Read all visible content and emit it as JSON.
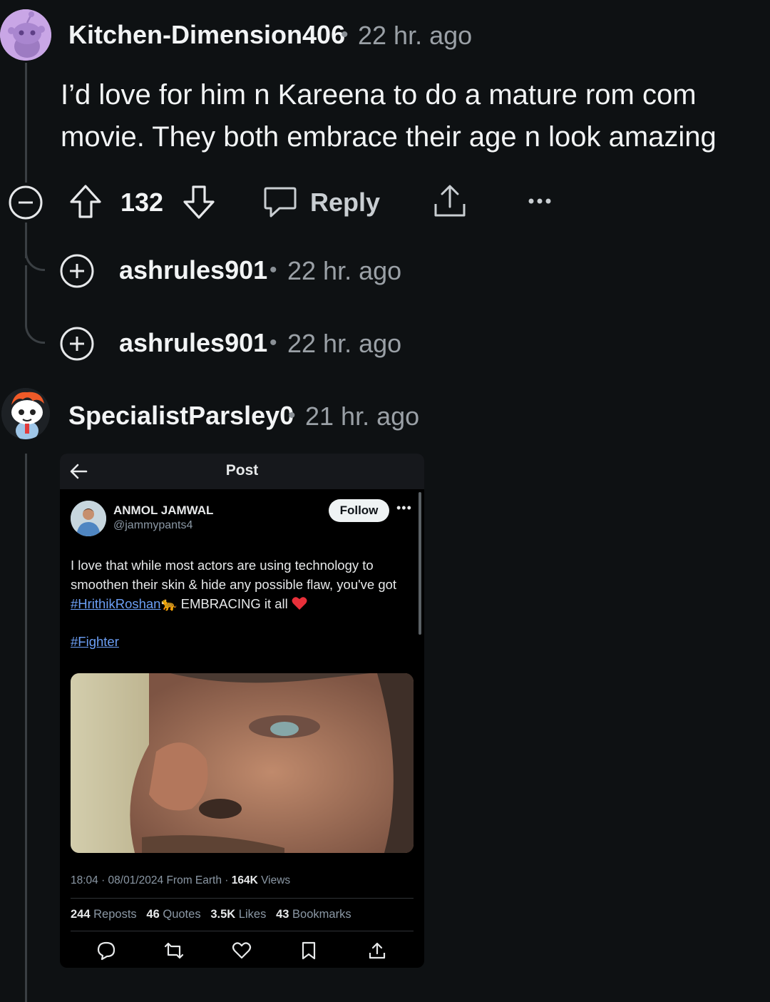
{
  "colors": {
    "background": "#0e1113",
    "thread_line": "#3a3f43",
    "link": "#6c9ff5",
    "heart": "#e8303a"
  },
  "comments": [
    {
      "username": "Kitchen-Dimension406",
      "separator": "•",
      "time": "22 hr. ago",
      "body": "I’d love for him n Kareena to do a mature rom com movie. They both embrace their age n look amazing",
      "score": "132",
      "reply_label": "Reply",
      "icons": [
        "collapse-icon",
        "upvote-icon",
        "downvote-icon",
        "comment-bubble-icon",
        "share-icon",
        "more-icon"
      ]
    }
  ],
  "collapsed_replies": [
    {
      "username": "ashrules901",
      "separator": "•",
      "time": "22 hr. ago",
      "icon": "expand-icon"
    },
    {
      "username": "ashrules901",
      "separator": "•",
      "time": "22 hr. ago",
      "icon": "expand-icon"
    }
  ],
  "second_comment": {
    "username": "SpecialistParsley0",
    "separator": "•",
    "time": "21 hr. ago"
  },
  "embedded_post": {
    "header_title": "Post",
    "author_name": "ANMOL JAMWAL",
    "author_handle": "@jammypants4",
    "follow_label": "Follow",
    "more_label": "•••",
    "text_part1": "I love that while most actors are using technology to smoothen their skin & hide any possible flaw, you've got ",
    "text_link": "#HrithikRoshan",
    "text_part2": " EMBRACING it all",
    "hashtag": "#Fighter",
    "meta_prefix": "18:04 · 08/01/2024 From Earth · ",
    "views_count": "164K",
    "views_label": " Views",
    "stats": [
      {
        "count": "244",
        "label": "Reposts"
      },
      {
        "count": "46",
        "label": "Quotes"
      },
      {
        "count": "3.5K",
        "label": "Likes"
      },
      {
        "count": "43",
        "label": "Bookmarks"
      }
    ],
    "action_icons": [
      "reply-icon",
      "repost-icon",
      "like-icon",
      "bookmark-icon",
      "share-icon"
    ]
  }
}
